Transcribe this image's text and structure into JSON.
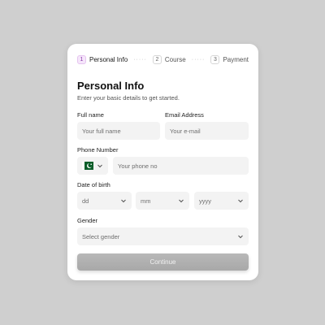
{
  "stepper": {
    "steps": [
      {
        "num": "1",
        "label": "Personal Info",
        "active": true
      },
      {
        "num": "2",
        "label": "Course",
        "active": false
      },
      {
        "num": "3",
        "label": "Payment",
        "active": false
      }
    ],
    "separator": "·····"
  },
  "form": {
    "title": "Personal Info",
    "subtitle": "Enter your basic details to get started.",
    "full_name": {
      "label": "Full name",
      "placeholder": "Your full name"
    },
    "email": {
      "label": "Email Address",
      "placeholder": "Your e-mail"
    },
    "phone": {
      "label": "Number",
      "label_full": "Phone Number",
      "placeholder": "Your phone no",
      "country_flag_icon": "pakistan-flag-icon"
    },
    "dob": {
      "label": "Date of birth",
      "day": "dd",
      "month": "mm",
      "year": "yyyy"
    },
    "gender": {
      "label": "Gender",
      "placeholder": "Select gender"
    },
    "continue_label": "Continue"
  },
  "colors": {
    "background": "#cfcfcf",
    "card": "#ffffff",
    "field": "#f3f3f3",
    "active_step": "#f6e6fb",
    "button": "#b0b0b0"
  }
}
